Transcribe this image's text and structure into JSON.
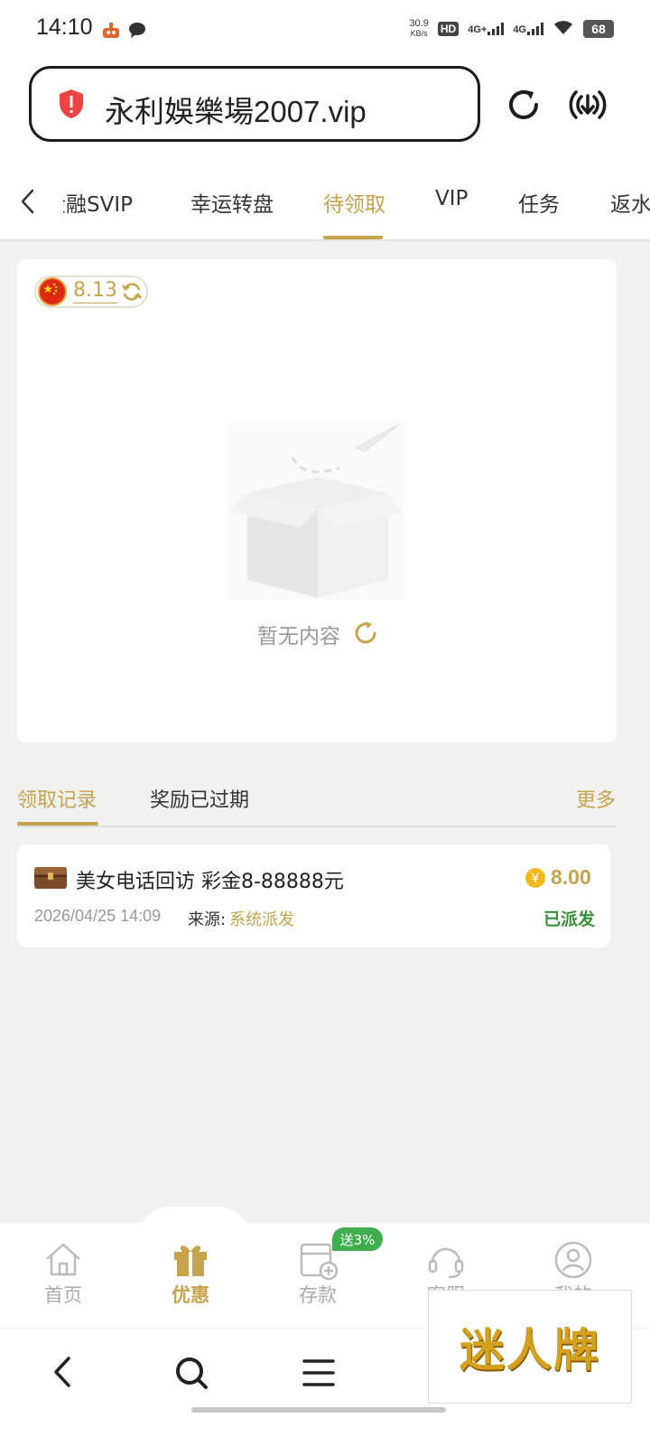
{
  "status_bar": {
    "time": "14:10",
    "net_speed": "30.9",
    "net_unit": "KB/s",
    "hd": "HD",
    "sig1": "4G+",
    "sig2": "4G",
    "battery": "68"
  },
  "browser": {
    "url": "永利娛樂場2007.vip",
    "accent_color": "#ef4444"
  },
  "tabs": [
    "金融SVIP",
    "幸运转盘",
    "待领取",
    "VIP",
    "任务",
    "返水"
  ],
  "active_tab": "待领取",
  "wallet": {
    "balance": "8.13",
    "currency_flag": "cn-flag"
  },
  "empty_state": {
    "text": "暂无内容"
  },
  "record_tabs": {
    "claim_records": "领取记录",
    "expired": "奖励已过期",
    "more": "更多"
  },
  "record": {
    "title": "美女电话回访 彩金8-88888元",
    "amount": "8.00",
    "date": "2026/04/25 14:09",
    "source_label": "来源:",
    "source_value": "系统派发",
    "status": "已派发"
  },
  "bottom_nav": {
    "items": [
      "首页",
      "优惠",
      "存款",
      "客服",
      "我的"
    ],
    "active": "优惠",
    "deposit_badge": "送3%"
  },
  "watermark": "迷人牌",
  "colors": {
    "gold": "#c6a34c",
    "green": "#3a8f3a",
    "badge_green": "#3fae4e"
  }
}
